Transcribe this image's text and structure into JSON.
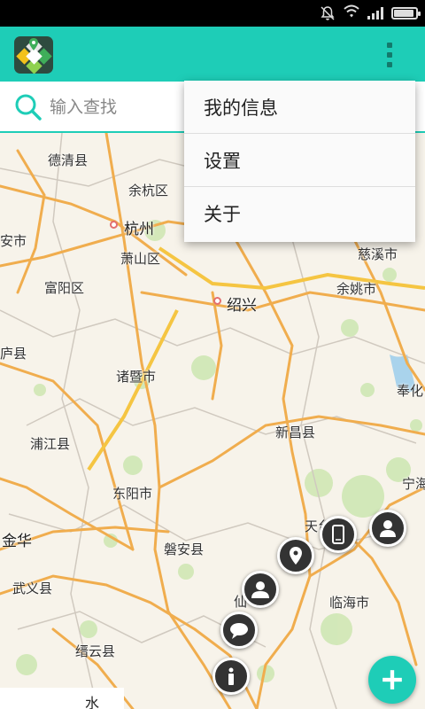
{
  "status_bar": {
    "icons": [
      "mute-icon",
      "wifi-icon",
      "signal-icon",
      "battery-icon"
    ],
    "battery_level": 0.9
  },
  "app_bar": {
    "logo": "app-map-logo-icon",
    "overflow_icon": "more-vert-icon",
    "color": "#1ecdb7"
  },
  "search": {
    "placeholder": "输入查找",
    "icon": "search-icon"
  },
  "menu": {
    "items": [
      {
        "label": "我的信息"
      },
      {
        "label": "设置"
      },
      {
        "label": "关于"
      }
    ]
  },
  "map": {
    "labels": [
      {
        "text": "德清县"
      },
      {
        "text": "余杭区"
      },
      {
        "text": "杭州"
      },
      {
        "text": "安市"
      },
      {
        "text": "萧山区"
      },
      {
        "text": "富阳区"
      },
      {
        "text": "绍兴"
      },
      {
        "text": "慈溪市"
      },
      {
        "text": "余姚市"
      },
      {
        "text": "庐县"
      },
      {
        "text": "诸暨市"
      },
      {
        "text": "奉化"
      },
      {
        "text": "新昌县"
      },
      {
        "text": "浦江县"
      },
      {
        "text": "宁海"
      },
      {
        "text": "东阳市"
      },
      {
        "text": "天台"
      },
      {
        "text": "金华"
      },
      {
        "text": "磐安县"
      },
      {
        "text": "武义县"
      },
      {
        "text": "仙"
      },
      {
        "text": "临海市"
      },
      {
        "text": "缙云县"
      },
      {
        "text": "水"
      }
    ]
  },
  "map_actions": [
    {
      "name": "contact-icon"
    },
    {
      "name": "phone-icon"
    },
    {
      "name": "location-pin-icon"
    },
    {
      "name": "group-icon"
    },
    {
      "name": "chat-bubble-icon"
    },
    {
      "name": "info-icon"
    }
  ],
  "add_button": {
    "icon": "plus-icon",
    "color": "#1ecdb7"
  }
}
